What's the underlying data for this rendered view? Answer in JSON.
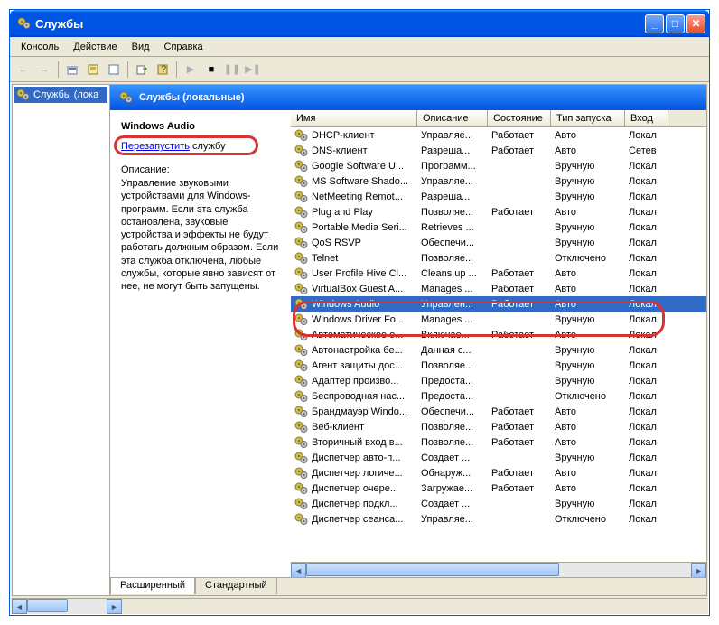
{
  "window": {
    "title": "Службы"
  },
  "menu": [
    "Консоль",
    "Действие",
    "Вид",
    "Справка"
  ],
  "tree": {
    "rootLabel": "Службы (лока"
  },
  "header": {
    "title": "Службы (локальные)"
  },
  "selectedService": {
    "name": "Windows Audio",
    "restartLinkPart1": "Перезапустить",
    "restartLinkPart2": " службу",
    "descLabel": "Описание:",
    "description": "Управление звуковыми устройствами для Windows-программ. Если эта служба остановлена, звуковые устройства и эффекты не будут работать должным образом. Если эта служба отключена, любые службы, которые явно зависят от нее, не могут быть запущены."
  },
  "columns": [
    "Имя",
    "Описание",
    "Состояние",
    "Тип запуска",
    "Вход"
  ],
  "tabs": {
    "extended": "Расширенный",
    "standard": "Стандартный"
  },
  "rows": [
    {
      "name": "DHCP-клиент",
      "desc": "Управляе...",
      "state": "Работает",
      "start": "Авто",
      "logon": "Локал"
    },
    {
      "name": "DNS-клиент",
      "desc": "Разреша...",
      "state": "Работает",
      "start": "Авто",
      "logon": "Сетев"
    },
    {
      "name": "Google Software U...",
      "desc": "Программ...",
      "state": "",
      "start": "Вручную",
      "logon": "Локал"
    },
    {
      "name": "MS Software Shado...",
      "desc": "Управляе...",
      "state": "",
      "start": "Вручную",
      "logon": "Локал"
    },
    {
      "name": "NetMeeting Remot...",
      "desc": "Разреша...",
      "state": "",
      "start": "Вручную",
      "logon": "Локал"
    },
    {
      "name": "Plug and Play",
      "desc": "Позволяе...",
      "state": "Работает",
      "start": "Авто",
      "logon": "Локал"
    },
    {
      "name": "Portable Media Seri...",
      "desc": "Retrieves ...",
      "state": "",
      "start": "Вручную",
      "logon": "Локал"
    },
    {
      "name": "QoS RSVP",
      "desc": "Обеспечи...",
      "state": "",
      "start": "Вручную",
      "logon": "Локал"
    },
    {
      "name": "Telnet",
      "desc": "Позволяе...",
      "state": "",
      "start": "Отключено",
      "logon": "Локал"
    },
    {
      "name": "User Profile Hive Cl...",
      "desc": "Cleans up ...",
      "state": "Работает",
      "start": "Авто",
      "logon": "Локал"
    },
    {
      "name": "VirtualBox Guest A...",
      "desc": "Manages ...",
      "state": "Работает",
      "start": "Авто",
      "logon": "Локал"
    },
    {
      "name": "Windows Audio",
      "desc": "Управлен...",
      "state": "Работает",
      "start": "Авто",
      "logon": "Локал",
      "selected": true
    },
    {
      "name": "Windows Driver Fo...",
      "desc": "Manages ...",
      "state": "",
      "start": "Вручную",
      "logon": "Локал"
    },
    {
      "name": "Автоматическое о...",
      "desc": "Включае...",
      "state": "Работает",
      "start": "Авто",
      "logon": "Локал"
    },
    {
      "name": "Автонастройка бе...",
      "desc": "Данная с...",
      "state": "",
      "start": "Вручную",
      "logon": "Локал"
    },
    {
      "name": "Агент защиты дос...",
      "desc": "Позволяе...",
      "state": "",
      "start": "Вручную",
      "logon": "Локал"
    },
    {
      "name": "Адаптер произво...",
      "desc": "Предоста...",
      "state": "",
      "start": "Вручную",
      "logon": "Локал"
    },
    {
      "name": "Беспроводная нас...",
      "desc": "Предоста...",
      "state": "",
      "start": "Отключено",
      "logon": "Локал"
    },
    {
      "name": "Брандмауэр Windo...",
      "desc": "Обеспечи...",
      "state": "Работает",
      "start": "Авто",
      "logon": "Локал"
    },
    {
      "name": "Веб-клиент",
      "desc": "Позволяе...",
      "state": "Работает",
      "start": "Авто",
      "logon": "Локал"
    },
    {
      "name": "Вторичный вход в...",
      "desc": "Позволяе...",
      "state": "Работает",
      "start": "Авто",
      "logon": "Локал"
    },
    {
      "name": "Диспетчер авто-п...",
      "desc": "Создает ...",
      "state": "",
      "start": "Вручную",
      "logon": "Локал"
    },
    {
      "name": "Диспетчер логиче...",
      "desc": "Обнаруж...",
      "state": "Работает",
      "start": "Авто",
      "logon": "Локал"
    },
    {
      "name": "Диспетчер очере...",
      "desc": "Загружае...",
      "state": "Работает",
      "start": "Авто",
      "logon": "Локал"
    },
    {
      "name": "Диспетчер подкл...",
      "desc": "Создает ...",
      "state": "",
      "start": "Вручную",
      "logon": "Локал"
    },
    {
      "name": "Диспетчер сеанса...",
      "desc": "Управляе...",
      "state": "",
      "start": "Отключено",
      "logon": "Локал"
    }
  ]
}
